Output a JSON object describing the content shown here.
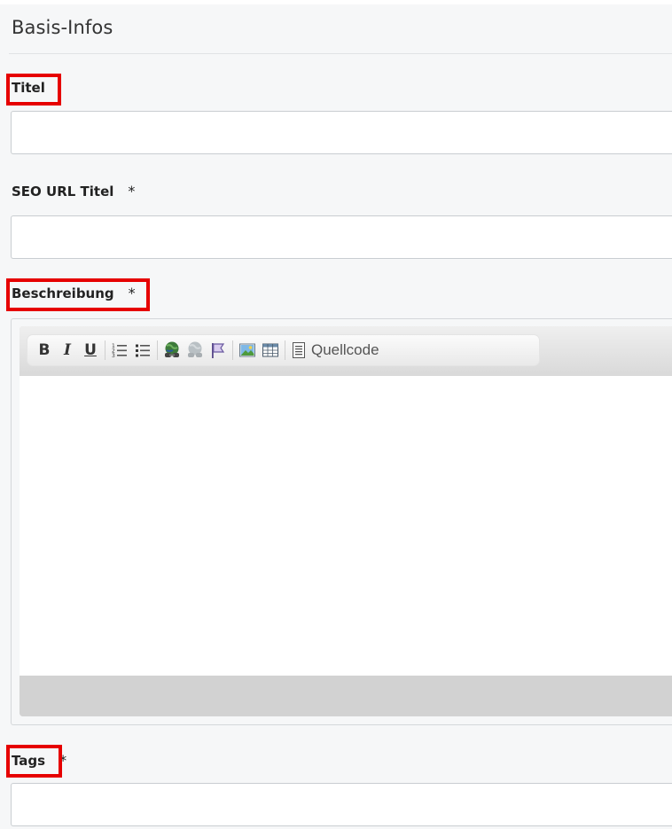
{
  "section": {
    "title": "Basis-Infos"
  },
  "fields": {
    "title": {
      "label": "Titel",
      "value": "",
      "placeholder": ""
    },
    "seo_url": {
      "label": "SEO URL Titel",
      "required_mark": "*",
      "value": "",
      "placeholder": ""
    },
    "description": {
      "label": "Beschreibung",
      "required_mark": "*"
    },
    "tags": {
      "label": "Tags",
      "required_mark": "*",
      "value": "",
      "placeholder": ""
    }
  },
  "editor": {
    "toolbar": [
      {
        "name": "bold-button",
        "glyph": "B"
      },
      {
        "name": "italic-button",
        "glyph": "I"
      },
      {
        "name": "underline-button",
        "glyph": "U"
      },
      {
        "name": "numbered-list-button",
        "icon": "numbered-list-icon"
      },
      {
        "name": "bulleted-list-button",
        "icon": "bulleted-list-icon"
      },
      {
        "name": "link-button",
        "icon": "link-icon"
      },
      {
        "name": "unlink-button",
        "icon": "unlink-icon"
      },
      {
        "name": "anchor-button",
        "icon": "flag-icon"
      },
      {
        "name": "image-button",
        "icon": "image-icon"
      },
      {
        "name": "table-button",
        "icon": "table-icon"
      }
    ],
    "source_label": "Quellcode"
  },
  "colors": {
    "highlight": "#e60000",
    "panel_background": "#f6f7f8"
  }
}
